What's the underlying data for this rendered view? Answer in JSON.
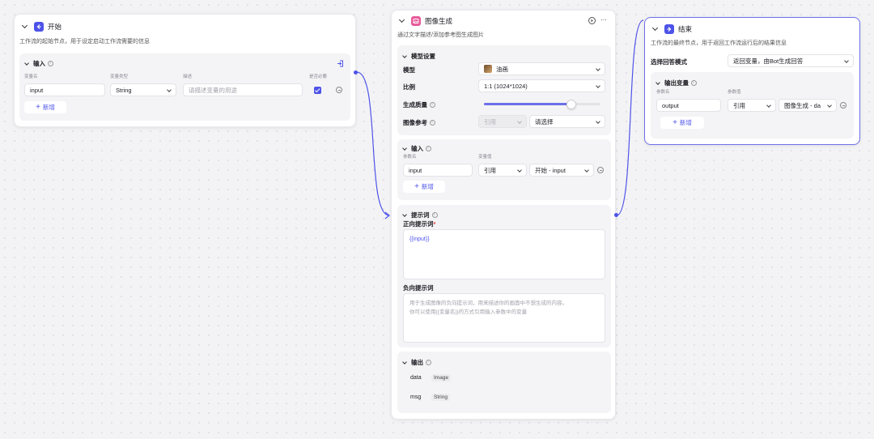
{
  "colors": {
    "accent": "#4d53e8",
    "selected_border": "#6d6fe8",
    "start_icon": "#4d53e8",
    "image_icon": "#e85b9a",
    "end_icon": "#4d53e8"
  },
  "start": {
    "title": "开始",
    "desc": "工作流的起始节点，用于设定启动工作流需要的信息",
    "input_section": "输入",
    "headers": {
      "name": "变量名",
      "type": "变量类型",
      "desc": "描述",
      "required": "是否必要"
    },
    "row": {
      "name": "input",
      "type": "String",
      "desc_placeholder": "请描述变量的用途",
      "required": true
    },
    "add": "新增"
  },
  "image": {
    "title": "图像生成",
    "desc": "通过文字描述/添加参考图生成图片",
    "model_section": "模型设置",
    "model_label": "模型",
    "model_value": "油画",
    "ratio_label": "比例",
    "ratio_value": "1:1 (1024*1024)",
    "quality_label": "生成质量",
    "quality_fraction": 0.75,
    "ref_label": "图像参考",
    "ref_type": "引用",
    "ref_placeholder": "请选择",
    "input_section": "输入",
    "input_headers": {
      "name": "参数名",
      "value": "变量值"
    },
    "input_row": {
      "name": "input",
      "type": "引用",
      "value": "开始 - input"
    },
    "add": "新增",
    "prompt_section": "提示词",
    "positive_label": "正向提示词",
    "positive_required": "*",
    "positive_value": "{{input}}",
    "negative_label": "负向提示词",
    "negative_placeholder_1": "用于生成图像的负向提示词，用来描述你的画面中不想生成的内容。",
    "negative_placeholder_2": "你可以使用{{变量名}}的方式引用输入参数中的变量",
    "output_section": "输出",
    "outputs": [
      {
        "name": "data",
        "type": "Image"
      },
      {
        "name": "msg",
        "type": "String"
      }
    ]
  },
  "end": {
    "title": "结束",
    "desc": "工作流的最终节点，用于返回工作流运行后的结果信息",
    "mode_label": "选择回答模式",
    "mode_value": "返回变量，由Bot生成回答",
    "output_section": "输出变量",
    "headers": {
      "name": "参数名",
      "value": "参数值"
    },
    "row": {
      "name": "output",
      "type": "引用",
      "value": "图像生成 - da"
    },
    "add": "新增"
  }
}
